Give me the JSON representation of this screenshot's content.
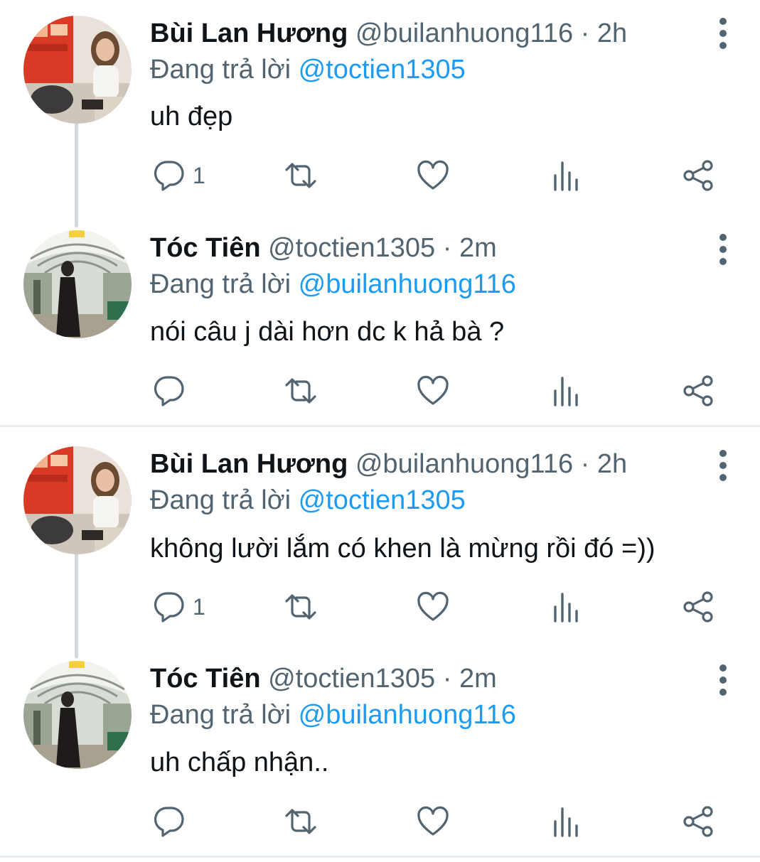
{
  "colors": {
    "text": "#0f1419",
    "secondary": "#536471",
    "link": "#1d9bf0",
    "divider": "#e6ecf0",
    "connector": "#cfd9de"
  },
  "icons": {
    "reply": "speech-bubble-icon",
    "retweet": "retweet-arrows-icon",
    "like": "heart-icon",
    "views": "bar-chart-icon",
    "share": "share-nodes-icon",
    "more": "vertical-dots-icon"
  },
  "threads": [
    {
      "tweets": [
        {
          "name": "Bùi Lan Hương",
          "handle": "@builanhuong116",
          "sep": "·",
          "time": "2h",
          "reply_prefix": "Đang trả lời",
          "reply_to": "@toctien1305",
          "text": "uh đẹp",
          "reply_count": "1"
        },
        {
          "name": "Tóc Tiên",
          "handle": "@toctien1305",
          "sep": "·",
          "time": "2m",
          "reply_prefix": "Đang trả lời",
          "reply_to": "@builanhuong116",
          "text": "nói câu j dài hơn dc k hả bà ?",
          "reply_count": ""
        }
      ]
    },
    {
      "tweets": [
        {
          "name": "Bùi Lan Hương",
          "handle": "@builanhuong116",
          "sep": "·",
          "time": "2h",
          "reply_prefix": "Đang trả lời",
          "reply_to": "@toctien1305",
          "text": "không lười lắm có khen là mừng rồi đó =))",
          "reply_count": "1"
        },
        {
          "name": "Tóc Tiên",
          "handle": "@toctien1305",
          "sep": "·",
          "time": "2m",
          "reply_prefix": "Đang trả lời",
          "reply_to": "@builanhuong116",
          "text": "uh chấp nhận..",
          "reply_count": ""
        }
      ]
    }
  ]
}
